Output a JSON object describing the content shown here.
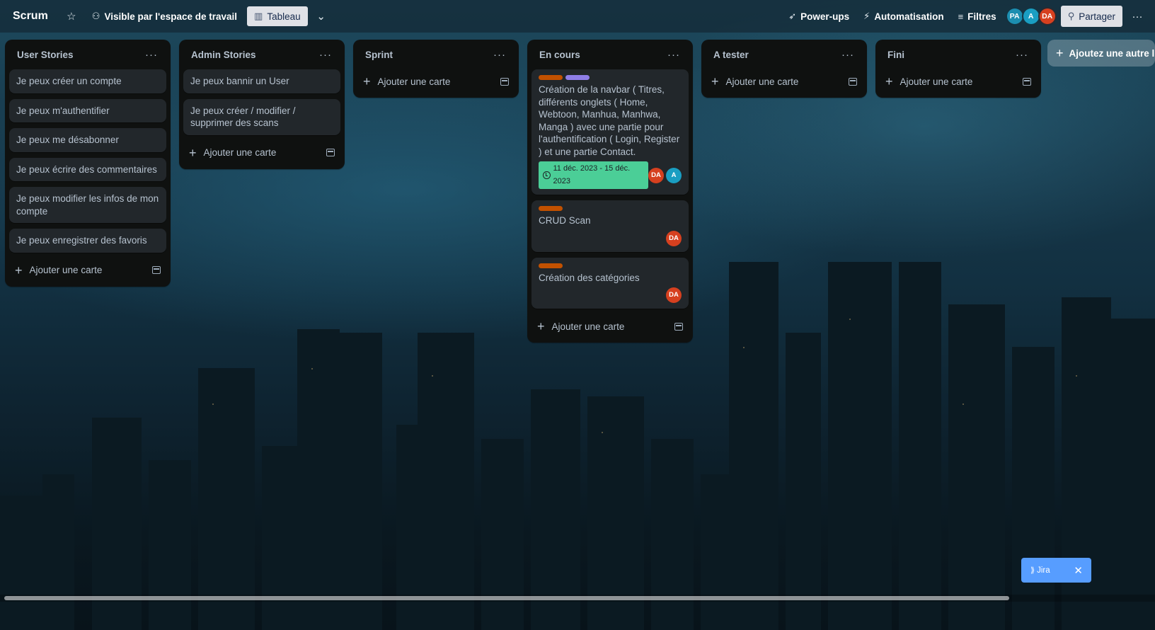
{
  "header": {
    "board_title": "Scrum",
    "visibility_label": "Visible par l'espace de travail",
    "view_label": "Tableau",
    "powerups_label": "Power-ups",
    "automation_label": "Automatisation",
    "filters_label": "Filtres",
    "members": [
      "PA",
      "A",
      "DA"
    ],
    "share_label": "Partager"
  },
  "lists": [
    {
      "title": "User Stories",
      "cards": [
        "Je peux créer un compte",
        "Je peux m'authentifier",
        "Je peux me désabonner",
        "Je peux écrire des commentaires",
        "Je peux modifier les infos de mon compte",
        "Je peux enregistrer des favoris"
      ],
      "add_label": "Ajouter une carte"
    },
    {
      "title": "Admin Stories",
      "cards": [
        "Je peux bannir un User",
        "Je peux créer / modifier / supprimer des scans"
      ],
      "add_label": "Ajouter une carte"
    },
    {
      "title": "Sprint",
      "cards": [],
      "add_label": "Ajouter une carte"
    },
    {
      "title": "En cours",
      "rich_cards": [
        {
          "labels": [
            "#c25100",
            "#8f7ee7"
          ],
          "title": "Création de la navbar ( Titres, différents onglets ( Home, Webtoon, Manhua, Manhwa, Manga ) avec une partie pour l'authentification ( Login, Register ) et une partie Contact.",
          "dates": "11 déc. 2023 - 15 déc. 2023",
          "members": [
            "DA",
            "A"
          ]
        },
        {
          "labels": [
            "#c25100"
          ],
          "title": "CRUD Scan",
          "members": [
            "DA"
          ]
        },
        {
          "labels": [
            "#c25100"
          ],
          "title": "Création des catégories",
          "members": [
            "DA"
          ]
        }
      ],
      "add_label": "Ajouter une carte"
    },
    {
      "title": "A tester",
      "cards": [],
      "add_label": "Ajouter une carte"
    },
    {
      "title": "Fini",
      "cards": [],
      "add_label": "Ajouter une carte"
    }
  ],
  "add_list_label": "Ajoutez une autre liste",
  "jira_label": "Jira",
  "colors": {
    "list_bg": "#0f1110",
    "card_bg": "#22272b",
    "date_badge": "#4bce97",
    "avatar_da": "#d6401f",
    "avatar_a": "#1a9ec2",
    "jira": "#579dff"
  }
}
